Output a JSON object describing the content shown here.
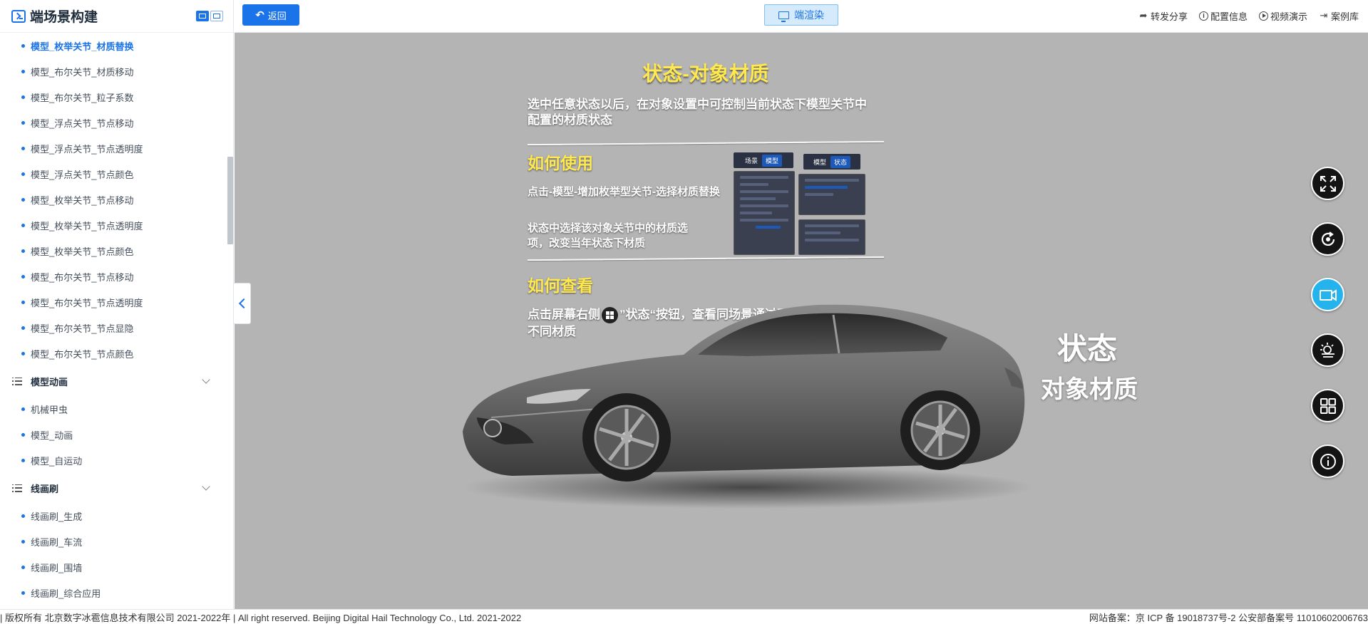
{
  "sidebar": {
    "title": "端场景构建",
    "items": [
      {
        "label": "模型_枚举关节_材质替换",
        "active": true
      },
      {
        "label": "模型_布尔关节_材质移动"
      },
      {
        "label": "模型_布尔关节_粒子系数"
      },
      {
        "label": "模型_浮点关节_节点移动"
      },
      {
        "label": "模型_浮点关节_节点透明度"
      },
      {
        "label": "模型_浮点关节_节点颜色"
      },
      {
        "label": "模型_枚举关节_节点移动"
      },
      {
        "label": "模型_枚举关节_节点透明度"
      },
      {
        "label": "模型_枚举关节_节点颜色"
      },
      {
        "label": "模型_布尔关节_节点移动"
      },
      {
        "label": "模型_布尔关节_节点透明度"
      },
      {
        "label": "模型_布尔关节_节点显隐"
      },
      {
        "label": "模型_布尔关节_节点颜色"
      }
    ],
    "groups": [
      {
        "label": "模型动画",
        "items": [
          "机械甲虫",
          "模型_动画",
          "模型_自运动"
        ]
      },
      {
        "label": "线画刷",
        "items": [
          "线画刷_生成",
          "线画刷_车流",
          "线画刷_围墙",
          "线画刷_综合应用"
        ]
      }
    ]
  },
  "topbar": {
    "back_label": "返回",
    "render_label": "端渲染",
    "links": [
      "转发分享",
      "配置信息",
      "视频演示",
      "案例库"
    ]
  },
  "slide": {
    "title": "状态-对象材质",
    "description": "选中任意状态以后，在对象设置中可控制当前状态下模型关节中配置的材质状态",
    "how_use_heading": "如何使用",
    "how_use_step1": "点击-模型-增加枚举型关节-选择材质替换",
    "how_use_step2": "状态中选择该对象关节中的材质选项，改变当年状态下材质",
    "mini_ui_tab1": "场景",
    "mini_ui_tab2": "模型",
    "mini_ui_tab3": "模型",
    "mini_ui_tab4": "状态",
    "how_view_heading": "如何查看",
    "how_view_before": "点击屏幕右侧",
    "how_view_after": "”状态“按钮，查看同场景通过不同状态同一对象不同材质",
    "car_label_1": "状态",
    "car_label_2": "对象材质"
  },
  "tools": [
    "fullscreen-icon",
    "refresh-icon",
    "camera-icon",
    "weather-icon",
    "grid-state-icon",
    "info-icon"
  ],
  "footer": {
    "left": "| 版权所有 北京数字冰雹信息技术有限公司 2021-2022年 | All right reserved. Beijing Digital Hail Technology Co., Ltd. 2021-2022",
    "right": "网站备案：京 ICP 备 19018737号-2 公安部备案号 11010602006763"
  },
  "colors": {
    "accent": "#1a73e8",
    "highlight": "#ffe94e",
    "tool_active": "#25b3ee"
  }
}
